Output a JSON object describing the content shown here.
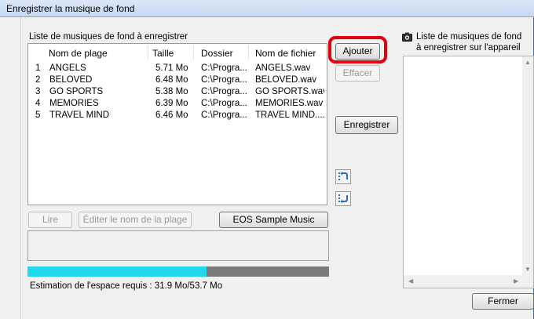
{
  "window": {
    "title": "Enregistrer la musique de fond"
  },
  "left_panel": {
    "caption": "Liste de musiques de fond à enregistrer",
    "columns": [
      "",
      "Nom de plage",
      "Taille",
      "Dossier",
      "Nom de fichier"
    ],
    "rows": [
      {
        "num": "1",
        "name": "ANGELS",
        "size": "5.71 Mo",
        "folder": "C:\\Progra...",
        "file": "ANGELS.wav"
      },
      {
        "num": "2",
        "name": "BELOVED",
        "size": "6.48 Mo",
        "folder": "C:\\Progra...",
        "file": "BELOVED.wav"
      },
      {
        "num": "3",
        "name": "GO SPORTS",
        "size": "5.38 Mo",
        "folder": "C:\\Progra...",
        "file": "GO SPORTS.wav"
      },
      {
        "num": "4",
        "name": "MEMORIES",
        "size": "6.39 Mo",
        "folder": "C:\\Progra...",
        "file": "MEMORIES.wav"
      },
      {
        "num": "5",
        "name": "TRAVEL MIND",
        "size": "6.46 Mo",
        "folder": "C:\\Progra...",
        "file": "TRAVEL MIND...."
      }
    ],
    "buttons": {
      "play": "Lire",
      "edit_name": "Éditer le nom de la plage",
      "sample": "EOS Sample Music"
    },
    "progress": {
      "fraction": 0.594,
      "fill_color": "#22d8ee",
      "track_color": "#7a7a7a"
    },
    "estimate": "Estimation de l'espace requis : 31.9 Mo/53.7 Mo"
  },
  "middle_buttons": {
    "add": "Ajouter",
    "delete": "Effacer",
    "register": "Enregistrer",
    "highlight_color": "#e2000f"
  },
  "right_panel": {
    "caption_line1": "Liste de musiques de fond",
    "caption_line2": "à enregistrer sur l'appareil",
    "icon": "camera-icon"
  },
  "footer": {
    "close": "Fermer"
  }
}
